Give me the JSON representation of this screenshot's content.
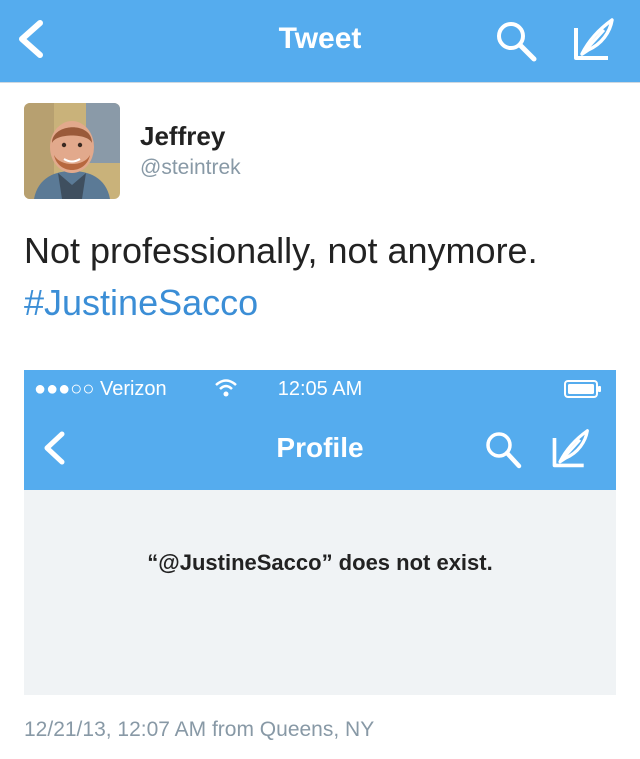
{
  "header": {
    "title": "Tweet",
    "back_icon": "chevron-left-icon",
    "search_icon": "search-icon",
    "compose_icon": "compose-icon",
    "background": "#55acee"
  },
  "tweet": {
    "author_name": "Jeffrey",
    "author_handle": "@steintrek",
    "text": "Not professionally, not anymore.",
    "hashtag": "#JustineSacco",
    "hashtag_color": "#3b8ed6",
    "meta": "12/21/13, 12:07 AM from Queens, NY"
  },
  "embedded_screenshot": {
    "status_bar": {
      "carrier": "●●●○○ Verizon",
      "time": "12:05 AM"
    },
    "nav": {
      "title": "Profile"
    },
    "message": "“@JustineSacco” does not exist."
  }
}
